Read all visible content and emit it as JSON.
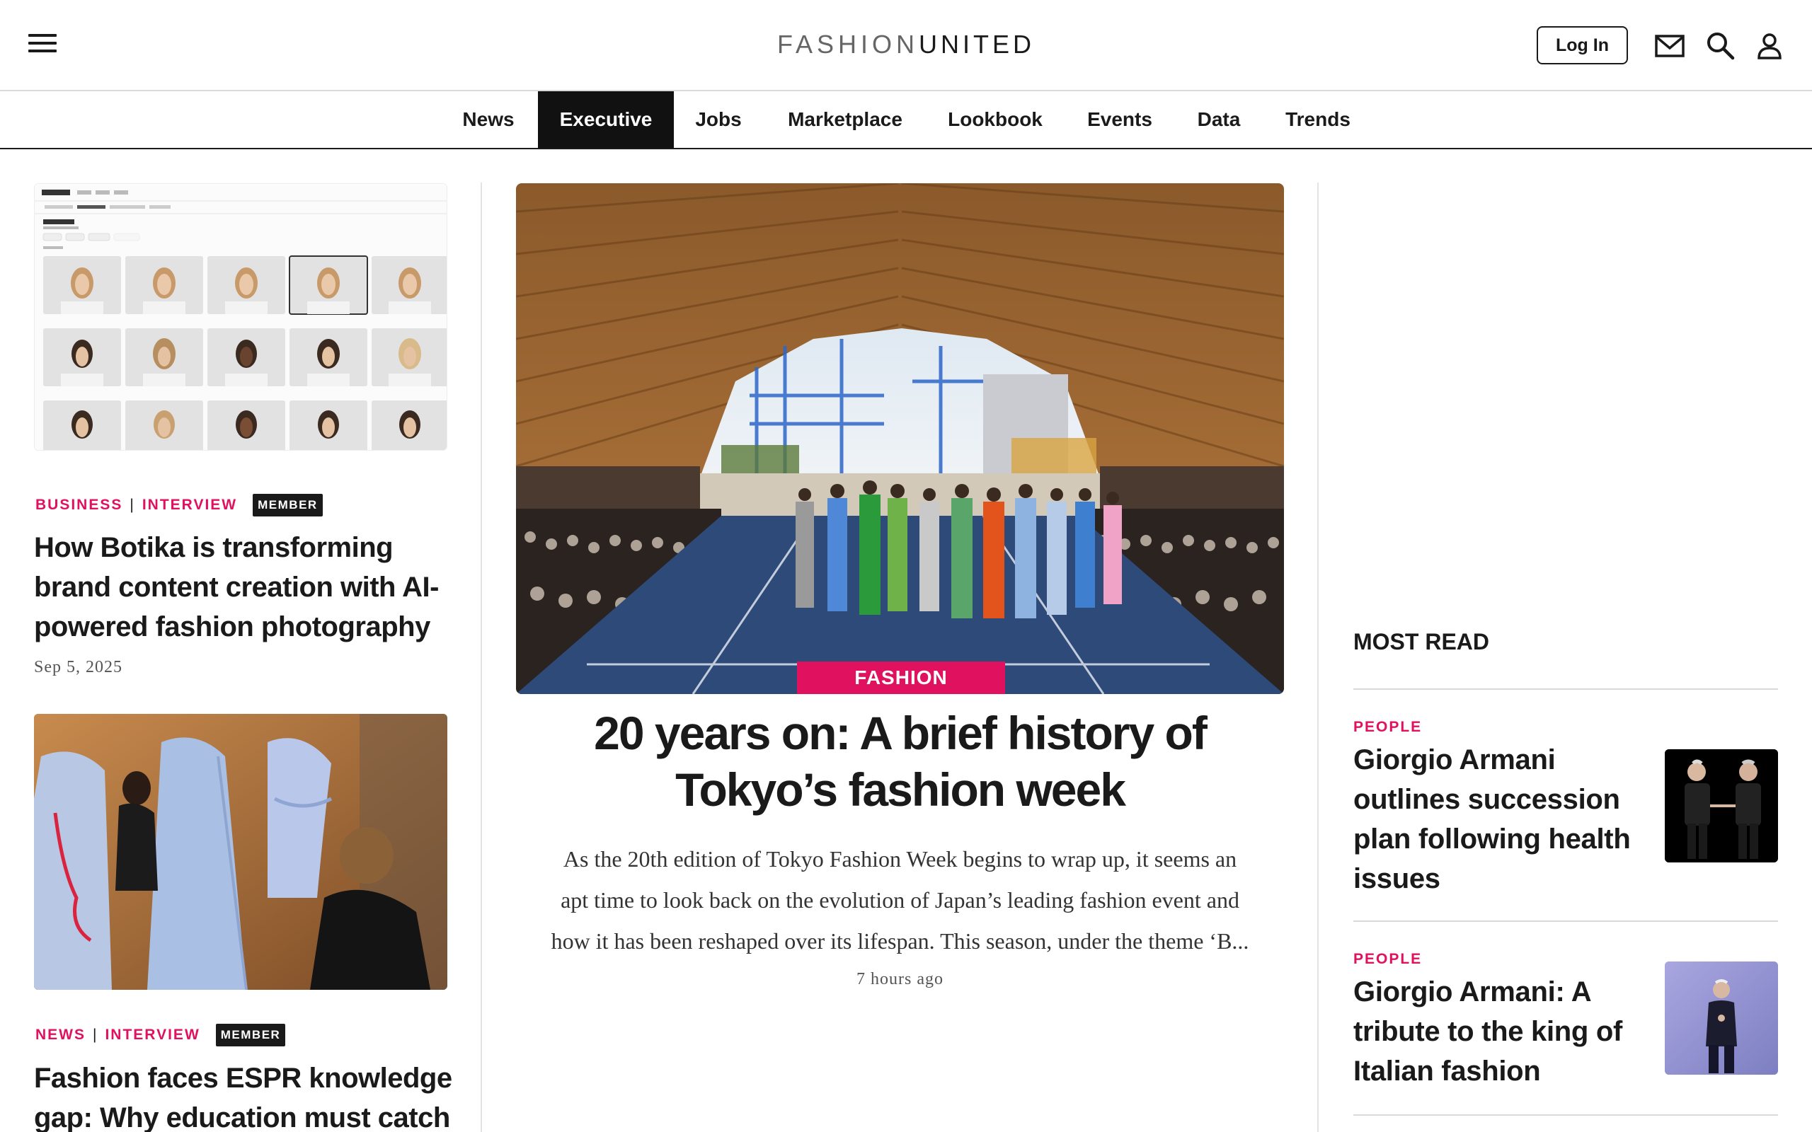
{
  "header": {
    "logo_light": "FASHION",
    "logo_bold": "UNITED",
    "login_label": "Log In",
    "menu_icon": "hamburger-menu-icon",
    "mail_icon": "envelope-icon",
    "search_icon": "search-icon",
    "account_icon": "user-account-icon"
  },
  "nav": {
    "items": [
      {
        "label": "News",
        "active": false
      },
      {
        "label": "Executive",
        "active": true
      },
      {
        "label": "Jobs",
        "active": false
      },
      {
        "label": "Marketplace",
        "active": false
      },
      {
        "label": "Lookbook",
        "active": false
      },
      {
        "label": "Events",
        "active": false
      },
      {
        "label": "Data",
        "active": false
      },
      {
        "label": "Trends",
        "active": false
      }
    ]
  },
  "left_column": {
    "articles": [
      {
        "category_1": "BUSINESS",
        "separator": "|",
        "category_2": "INTERVIEW",
        "badge": "MEMBER",
        "title_lines": [
          "How Botika is transforming",
          "brand content creation with AI-",
          "powered fashion photography"
        ],
        "date": "Sep 5, 2025"
      },
      {
        "category_1": "NEWS",
        "separator": "|",
        "category_2": "INTERVIEW",
        "badge": "MEMBER",
        "title_lines": [
          "Fashion faces ESPR knowledge",
          "gap: Why education must catch"
        ]
      }
    ]
  },
  "featured": {
    "category": "FASHION",
    "title_lines": [
      "20 years on: A brief history of",
      "Tokyo’s fashion week"
    ],
    "excerpt_lines": [
      "As the 20th edition of Tokyo Fashion Week begins to wrap up, it seems an",
      "apt time to look back on the evolution of Japan’s leading fashion event and",
      "how it has been reshaped over its lifespan. This season, under the theme ‘B..."
    ],
    "time": "7 hours ago"
  },
  "most_read": {
    "heading": "MOST READ",
    "items": [
      {
        "category": "PEOPLE",
        "title_lines": [
          "Giorgio Armani",
          "outlines succession",
          "plan following health",
          "issues"
        ]
      },
      {
        "category": "PEOPLE",
        "title_lines": [
          "Giorgio Armani: A",
          "tribute to the king of",
          "Italian fashion"
        ]
      }
    ]
  },
  "colors": {
    "accent": "#e0115f",
    "text": "#1a1a1a",
    "nav_active_bg": "#111111"
  }
}
